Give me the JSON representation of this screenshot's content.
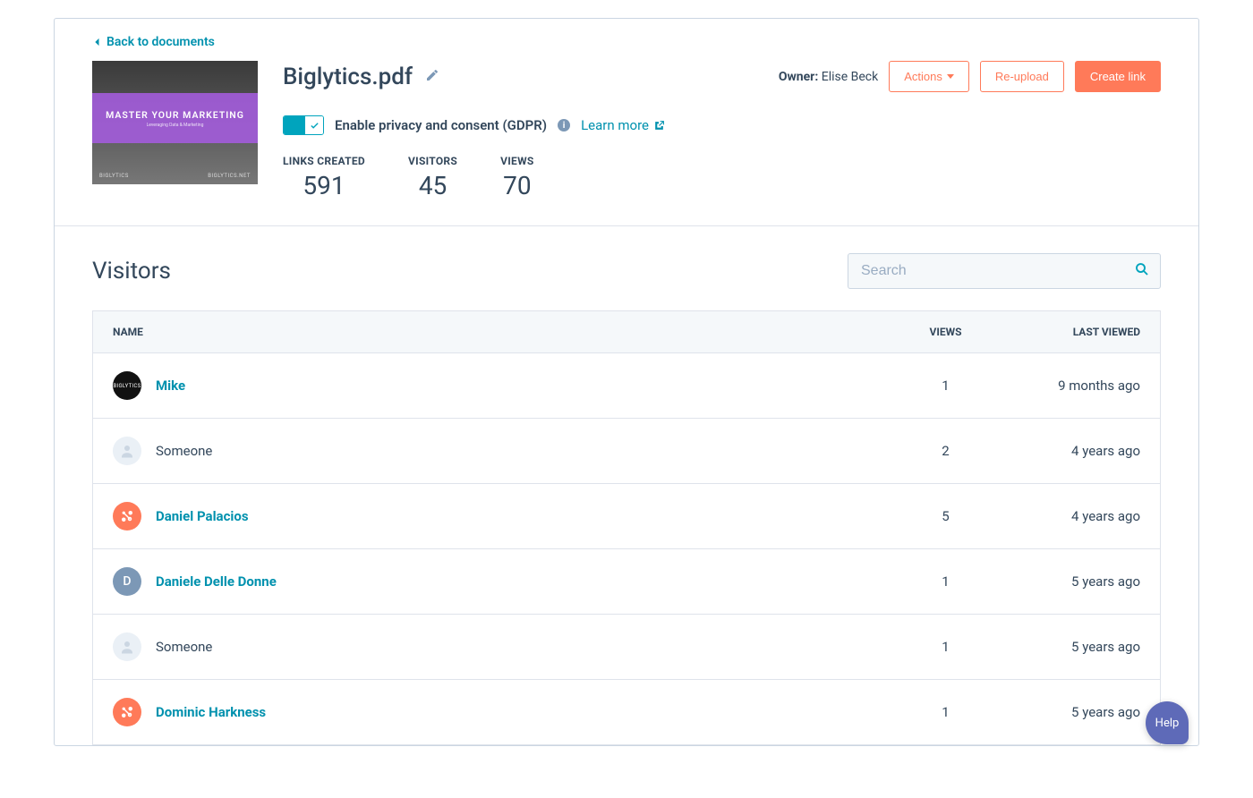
{
  "back_link": "Back to documents",
  "document": {
    "title": "Biglytics.pdf",
    "thumb_title": "MASTER YOUR MARKETING",
    "thumb_footer_left": "BIGLYTICS",
    "thumb_footer_right": "BIGLYTICS.NET"
  },
  "owner_label": "Owner:",
  "owner_name": "Elise Beck",
  "actions": {
    "actions_btn": "Actions",
    "reupload_btn": "Re-upload",
    "create_link_btn": "Create link"
  },
  "gdpr": {
    "label": "Enable privacy and consent (GDPR)",
    "learn_more": "Learn more"
  },
  "stats": {
    "links_created": {
      "label": "LINKS CREATED",
      "value": "591"
    },
    "visitors": {
      "label": "VISITORS",
      "value": "45"
    },
    "views": {
      "label": "VIEWS",
      "value": "70"
    }
  },
  "visitors_section": {
    "title": "Visitors",
    "search_placeholder": "Search",
    "columns": {
      "name": "NAME",
      "views": "VIEWS",
      "last_viewed": "LAST VIEWED"
    },
    "rows": [
      {
        "name": "Mike",
        "views": "1",
        "last_viewed": "9 months ago",
        "avatar_type": "black",
        "initial": "BIGLYTICS",
        "link": true
      },
      {
        "name": "Someone",
        "views": "2",
        "last_viewed": "4 years ago",
        "avatar_type": "gray",
        "initial": "",
        "link": false
      },
      {
        "name": "Daniel Palacios",
        "views": "5",
        "last_viewed": "4 years ago",
        "avatar_type": "orange",
        "initial": "",
        "link": true
      },
      {
        "name": "Daniele Delle Donne",
        "views": "1",
        "last_viewed": "5 years ago",
        "avatar_type": "blue",
        "initial": "D",
        "link": true
      },
      {
        "name": "Someone",
        "views": "1",
        "last_viewed": "5 years ago",
        "avatar_type": "gray",
        "initial": "",
        "link": false
      },
      {
        "name": "Dominic Harkness",
        "views": "1",
        "last_viewed": "5 years ago",
        "avatar_type": "orange",
        "initial": "",
        "link": true
      }
    ]
  },
  "help_label": "Help"
}
